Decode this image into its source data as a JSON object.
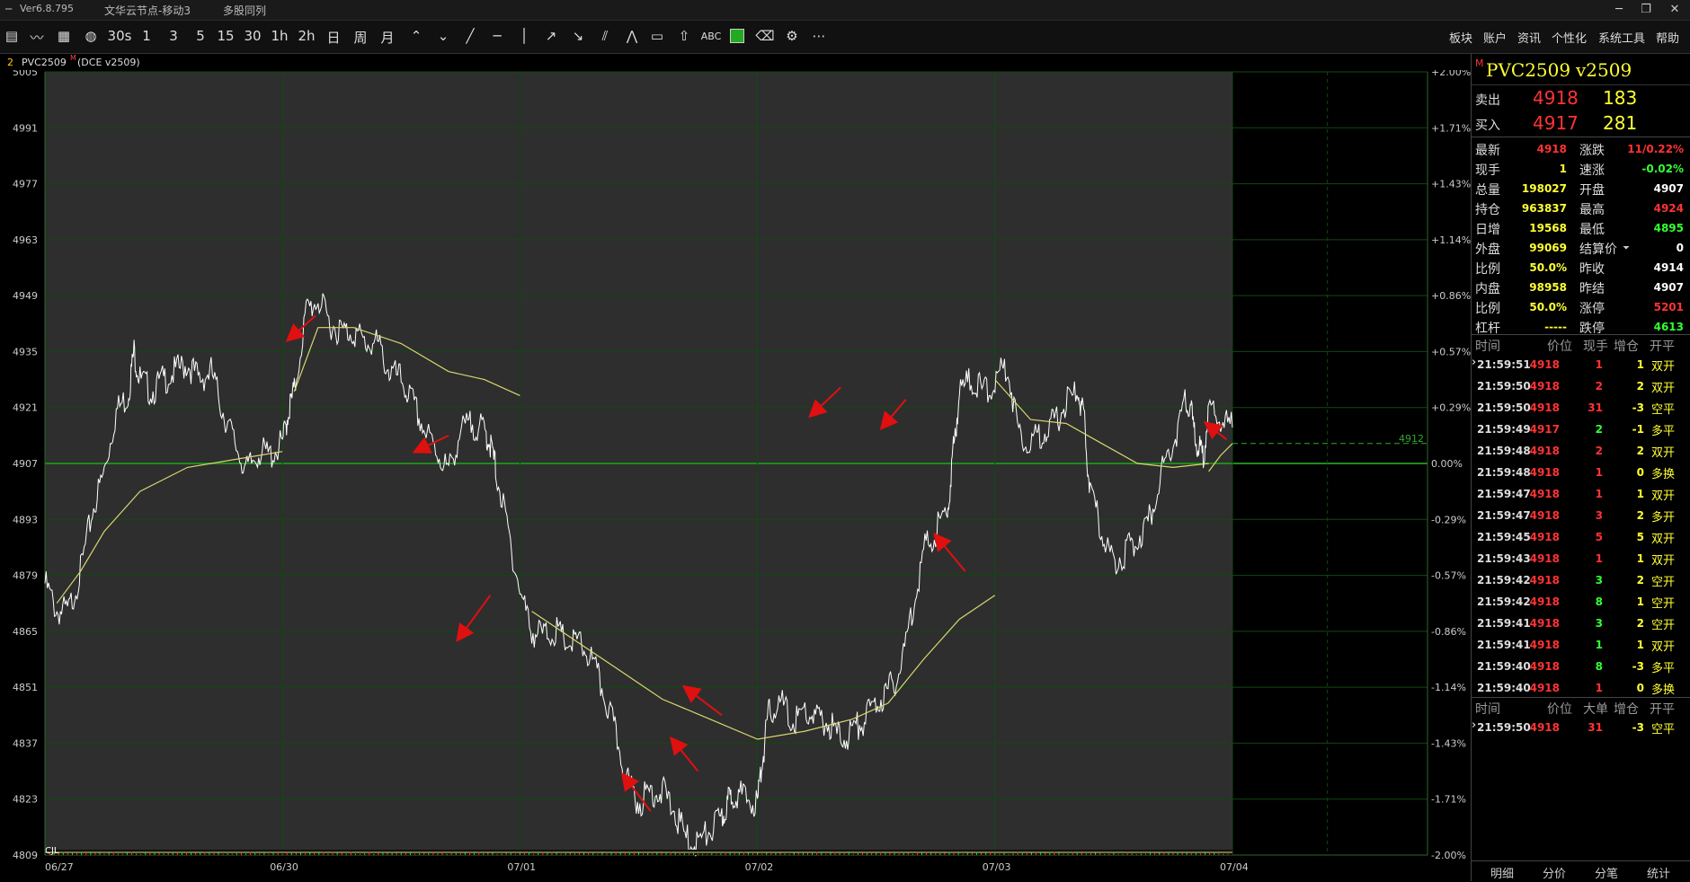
{
  "window": {
    "version": "Ver6.8.795",
    "server": "文华云节点-移动3",
    "view": "多股同列",
    "controls": [
      "─",
      "❐",
      "✕"
    ]
  },
  "toolbar": {
    "periods": [
      "30s",
      "1",
      "3",
      "5",
      "15",
      "30",
      "1h",
      "2h",
      "日",
      "周",
      "月"
    ],
    "right_menu": [
      "板块",
      "账户",
      "资讯",
      "个性化",
      "系统工具",
      "帮助"
    ]
  },
  "chart_header": {
    "index": "2",
    "symbol": "PVC2509",
    "symbol_sup": "M",
    "exchange": "(DCE v2509)"
  },
  "chart_data": {
    "type": "line",
    "y_ticks": [
      5005,
      4991,
      4977,
      4963,
      4949,
      4935,
      4921,
      4907,
      4893,
      4879,
      4865,
      4851,
      4837,
      4823,
      4809
    ],
    "pct_ticks": [
      "+2.00%",
      "+1.71%",
      "+1.43%",
      "+1.14%",
      "+0.86%",
      "+0.57%",
      "+0.29%",
      "0.00%",
      "-0.29%",
      "-0.57%",
      "-0.86%",
      "-1.14%",
      "-1.43%",
      "-1.71%",
      "-2.00%"
    ],
    "x_labels": [
      "06/27",
      "06/30",
      "07/01",
      "07/02",
      "07/03",
      "07/04"
    ],
    "ylim": [
      4809,
      5005
    ],
    "prev_settle": 4907,
    "last_price_label": "4912",
    "volume_label": "CJL",
    "price_series": [
      [
        0,
        4877
      ],
      [
        0.01,
        4870
      ],
      [
        0.02,
        4870
      ],
      [
        0.03,
        4880
      ],
      [
        0.04,
        4895
      ],
      [
        0.05,
        4905
      ],
      [
        0.06,
        4920
      ],
      [
        0.07,
        4924
      ],
      [
        0.075,
        4935
      ],
      [
        0.08,
        4928
      ],
      [
        0.09,
        4925
      ],
      [
        0.1,
        4928
      ],
      [
        0.11,
        4930
      ],
      [
        0.12,
        4932
      ],
      [
        0.13,
        4928
      ],
      [
        0.14,
        4930
      ],
      [
        0.15,
        4920
      ],
      [
        0.16,
        4912
      ],
      [
        0.17,
        4905
      ],
      [
        0.18,
        4910
      ],
      [
        0.19,
        4909
      ],
      [
        0.2,
        4912
      ],
      [
        0.205,
        4920
      ],
      [
        0.21,
        4925
      ],
      [
        0.22,
        4945
      ],
      [
        0.23,
        4948
      ],
      [
        0.24,
        4942
      ],
      [
        0.25,
        4940
      ],
      [
        0.26,
        4940
      ],
      [
        0.27,
        4937
      ],
      [
        0.28,
        4937
      ],
      [
        0.29,
        4930
      ],
      [
        0.3,
        4928
      ],
      [
        0.31,
        4922
      ],
      [
        0.32,
        4915
      ],
      [
        0.33,
        4910
      ],
      [
        0.34,
        4905
      ],
      [
        0.35,
        4915
      ],
      [
        0.36,
        4917
      ],
      [
        0.37,
        4915
      ],
      [
        0.375,
        4912
      ],
      [
        0.38,
        4905
      ],
      [
        0.39,
        4890
      ],
      [
        0.4,
        4875
      ],
      [
        0.41,
        4865
      ],
      [
        0.42,
        4864
      ],
      [
        0.43,
        4865
      ],
      [
        0.44,
        4862
      ],
      [
        0.45,
        4862
      ],
      [
        0.46,
        4858
      ],
      [
        0.47,
        4850
      ],
      [
        0.48,
        4840
      ],
      [
        0.49,
        4828
      ],
      [
        0.5,
        4822
      ],
      [
        0.51,
        4825
      ],
      [
        0.52,
        4825
      ],
      [
        0.53,
        4820
      ],
      [
        0.54,
        4813
      ],
      [
        0.55,
        4812
      ],
      [
        0.56,
        4815
      ],
      [
        0.57,
        4818
      ],
      [
        0.575,
        4822
      ],
      [
        0.58,
        4825
      ],
      [
        0.59,
        4823
      ],
      [
        0.6,
        4822
      ],
      [
        0.605,
        4835
      ],
      [
        0.61,
        4845
      ],
      [
        0.62,
        4847
      ],
      [
        0.63,
        4842
      ],
      [
        0.64,
        4845
      ],
      [
        0.65,
        4843
      ],
      [
        0.66,
        4842
      ],
      [
        0.67,
        4838
      ],
      [
        0.68,
        4840
      ],
      [
        0.69,
        4843
      ],
      [
        0.7,
        4847
      ],
      [
        0.71,
        4850
      ],
      [
        0.72,
        4855
      ],
      [
        0.73,
        4870
      ],
      [
        0.74,
        4885
      ],
      [
        0.75,
        4890
      ],
      [
        0.76,
        4895
      ],
      [
        0.765,
        4910
      ],
      [
        0.77,
        4925
      ],
      [
        0.78,
        4928
      ],
      [
        0.79,
        4925
      ],
      [
        0.8,
        4927
      ],
      [
        0.81,
        4932
      ],
      [
        0.82,
        4915
      ],
      [
        0.83,
        4912
      ],
      [
        0.84,
        4915
      ],
      [
        0.85,
        4917
      ],
      [
        0.86,
        4922
      ],
      [
        0.87,
        4925
      ],
      [
        0.875,
        4918
      ],
      [
        0.88,
        4900
      ],
      [
        0.89,
        4890
      ],
      [
        0.9,
        4882
      ],
      [
        0.91,
        4885
      ],
      [
        0.92,
        4888
      ],
      [
        0.93,
        4893
      ],
      [
        0.94,
        4905
      ],
      [
        0.95,
        4912
      ],
      [
        0.96,
        4922
      ],
      [
        0.965,
        4920
      ],
      [
        0.97,
        4912
      ],
      [
        0.975,
        4908
      ],
      [
        0.98,
        4920
      ],
      [
        0.99,
        4918
      ],
      [
        1.0,
        4916
      ]
    ],
    "avg_series": [
      [
        0.01,
        4872
      ],
      [
        0.03,
        4880
      ],
      [
        0.05,
        4890
      ],
      [
        0.08,
        4900
      ],
      [
        0.12,
        4906
      ],
      [
        0.18,
        4909
      ],
      [
        0.2,
        4910
      ],
      null,
      [
        0.21,
        4925
      ],
      [
        0.23,
        4941
      ],
      [
        0.26,
        4941
      ],
      [
        0.3,
        4937
      ],
      [
        0.34,
        4930
      ],
      [
        0.37,
        4928
      ],
      [
        0.4,
        4924
      ],
      null,
      [
        0.41,
        4870
      ],
      [
        0.44,
        4864
      ],
      [
        0.48,
        4856
      ],
      [
        0.52,
        4848
      ],
      [
        0.56,
        4843
      ],
      [
        0.6,
        4838
      ],
      [
        0.64,
        4840
      ],
      [
        0.68,
        4843
      ],
      [
        0.71,
        4847
      ],
      [
        0.74,
        4858
      ],
      [
        0.77,
        4868
      ],
      [
        0.8,
        4874
      ],
      null,
      [
        0.8,
        4928
      ],
      [
        0.83,
        4918
      ],
      [
        0.86,
        4917
      ],
      [
        0.89,
        4912
      ],
      [
        0.92,
        4907
      ],
      [
        0.95,
        4906
      ],
      [
        0.98,
        4907
      ],
      null,
      [
        0.98,
        4905
      ],
      [
        0.99,
        4909
      ],
      [
        1.0,
        4912
      ]
    ]
  },
  "quote": {
    "symbol_prefix": "M",
    "symbol": "PVC2509",
    "contract": "v2509",
    "sell": {
      "label": "卖出",
      "price": "4918",
      "vol": "183"
    },
    "buy": {
      "label": "买入",
      "price": "4917",
      "vol": "281"
    },
    "rows": [
      {
        "l1": "最新",
        "v1": "4918",
        "c1": "#ff3333",
        "l2": "涨跌",
        "v2": "11/0.22%",
        "c2": "#ff3333"
      },
      {
        "l1": "现手",
        "v1": "1",
        "c1": "#ffff33",
        "l2": "速涨",
        "v2": "-0.02%",
        "c2": "#33ff33"
      },
      {
        "l1": "总量",
        "v1": "198027",
        "c1": "#ffff33",
        "l2": "开盘",
        "v2": "4907",
        "c2": "#ffffff"
      },
      {
        "l1": "持仓",
        "v1": "963837",
        "c1": "#ffff33",
        "l2": "最高",
        "v2": "4924",
        "c2": "#ff3333"
      },
      {
        "l1": "日增",
        "v1": "19568",
        "c1": "#ffff33",
        "l2": "最低",
        "v2": "4895",
        "c2": "#33ff33"
      },
      {
        "l1": "外盘",
        "v1": "99069",
        "c1": "#ffff33",
        "l2": "结算价",
        "v2": "0",
        "c2": "#ffffff"
      },
      {
        "l1": "比例",
        "v1": "50.0%",
        "c1": "#ffff33",
        "l2": "昨收",
        "v2": "4914",
        "c2": "#ffffff"
      },
      {
        "l1": "内盘",
        "v1": "98958",
        "c1": "#ffff33",
        "l2": "昨结",
        "v2": "4907",
        "c2": "#ffffff"
      },
      {
        "l1": "比例",
        "v1": "50.0%",
        "c1": "#ffff33",
        "l2": "涨停",
        "v2": "5201",
        "c2": "#ff3333"
      },
      {
        "l1": "杠杆",
        "v1": "-----",
        "c1": "#ffff33",
        "l2": "跌停",
        "v2": "4613",
        "c2": "#33ff33"
      }
    ]
  },
  "trades": {
    "headers": [
      "时间",
      "价位",
      "现手",
      "增仓",
      "开平"
    ],
    "rows": [
      {
        "t": "21:59:51",
        "p": "4918",
        "v": "1",
        "vc": "#ff3333",
        "z": "1",
        "k": "双开",
        "kc": "#ffff33"
      },
      {
        "t": "21:59:50",
        "p": "4918",
        "v": "2",
        "vc": "#ff3333",
        "z": "2",
        "k": "双开",
        "kc": "#ffff33"
      },
      {
        "t": "21:59:50",
        "p": "4918",
        "v": "31",
        "vc": "#ff3333",
        "z": "-3",
        "k": "空平",
        "kc": "#ffff33"
      },
      {
        "t": "21:59:49",
        "p": "4917",
        "v": "2",
        "vc": "#33ff33",
        "z": "-1",
        "k": "多平",
        "kc": "#ffff33"
      },
      {
        "t": "21:59:48",
        "p": "4918",
        "v": "2",
        "vc": "#ff3333",
        "z": "2",
        "k": "双开",
        "kc": "#ffff33"
      },
      {
        "t": "21:59:48",
        "p": "4918",
        "v": "1",
        "vc": "#ff3333",
        "z": "0",
        "k": "多换",
        "kc": "#ffff33"
      },
      {
        "t": "21:59:47",
        "p": "4918",
        "v": "1",
        "vc": "#ff3333",
        "z": "1",
        "k": "双开",
        "kc": "#ffff33"
      },
      {
        "t": "21:59:47",
        "p": "4918",
        "v": "3",
        "vc": "#ff3333",
        "z": "2",
        "k": "多开",
        "kc": "#ffff33"
      },
      {
        "t": "21:59:45",
        "p": "4918",
        "v": "5",
        "vc": "#ff3333",
        "z": "5",
        "k": "双开",
        "kc": "#ffff33"
      },
      {
        "t": "21:59:43",
        "p": "4918",
        "v": "1",
        "vc": "#ff3333",
        "z": "1",
        "k": "双开",
        "kc": "#ffff33"
      },
      {
        "t": "21:59:42",
        "p": "4918",
        "v": "3",
        "vc": "#33ff33",
        "z": "2",
        "k": "空开",
        "kc": "#ffff33"
      },
      {
        "t": "21:59:42",
        "p": "4918",
        "v": "8",
        "vc": "#33ff33",
        "z": "1",
        "k": "空开",
        "kc": "#ffff33"
      },
      {
        "t": "21:59:41",
        "p": "4918",
        "v": "3",
        "vc": "#33ff33",
        "z": "2",
        "k": "空开",
        "kc": "#ffff33"
      },
      {
        "t": "21:59:41",
        "p": "4918",
        "v": "1",
        "vc": "#33ff33",
        "z": "1",
        "k": "双开",
        "kc": "#ffff33"
      },
      {
        "t": "21:59:40",
        "p": "4918",
        "v": "8",
        "vc": "#33ff33",
        "z": "-3",
        "k": "多平",
        "kc": "#ffff33"
      },
      {
        "t": "21:59:40",
        "p": "4918",
        "v": "1",
        "vc": "#ff3333",
        "z": "0",
        "k": "多换",
        "kc": "#ffff33"
      }
    ]
  },
  "bigtrades": {
    "headers": [
      "时间",
      "价位",
      "大单",
      "增仓",
      "开平"
    ],
    "rows": [
      {
        "t": "21:59:50",
        "p": "4918",
        "v": "31",
        "z": "-3",
        "k": "空平"
      }
    ]
  },
  "bottom_tabs": [
    "明细",
    "分价",
    "分笔",
    "统计"
  ]
}
